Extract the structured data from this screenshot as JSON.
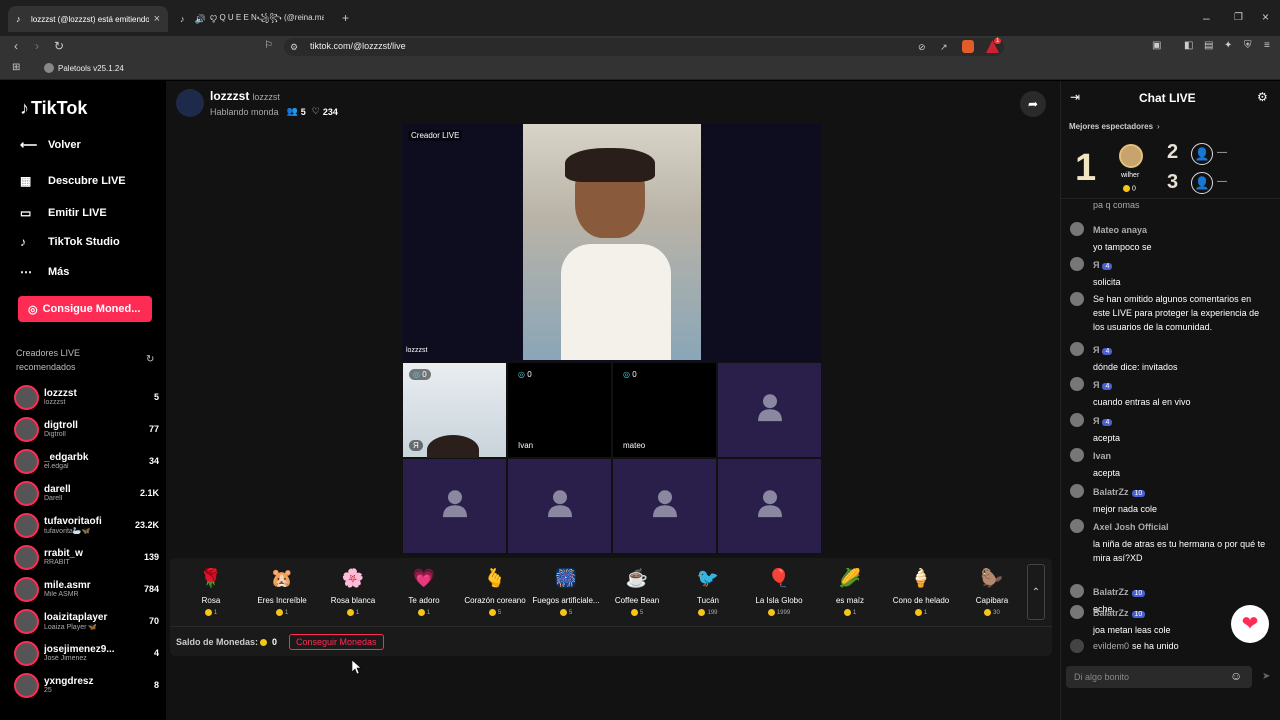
{
  "browser": {
    "tabs": [
      {
        "label": "lozzzst (@lozzzst) está emitiendo",
        "active": true
      },
      {
        "label": "ꨄ︎ Q U E E N꧁꧂ (@reina.may2",
        "active": false
      }
    ],
    "new_tab": "+",
    "url": "tiktok.com/@lozzzst/live",
    "bookmark": "Paletools v25.1.24",
    "ext_badge": "1"
  },
  "sidebar": {
    "logo": "TikTok",
    "nav": [
      {
        "label": "Volver",
        "icon": "back-icon"
      },
      {
        "label": "Descubre LIVE",
        "icon": "discover-icon"
      },
      {
        "label": "Emitir LIVE",
        "icon": "camera-icon"
      },
      {
        "label": "TikTok Studio",
        "icon": "studio-icon"
      },
      {
        "label": "Más",
        "icon": "more-icon"
      }
    ],
    "coin_button": "Consigue Moned...",
    "recommended_title": "Creadores LIVE recomendados",
    "creators": [
      {
        "name": "lozzzst",
        "sub": "lozzzst",
        "count": "5"
      },
      {
        "name": "digtroll",
        "sub": "Digtroll",
        "count": "77"
      },
      {
        "name": "_edgarbk",
        "sub": "el.edgal",
        "count": "34"
      },
      {
        "name": "darell",
        "sub": "Darell",
        "count": "2.1K"
      },
      {
        "name": "tufavoritaofi",
        "sub": "tufavorita🦢🦋",
        "count": "23.2K"
      },
      {
        "name": "rrabit_w",
        "sub": "RRABIT",
        "count": "139"
      },
      {
        "name": "mile.asmr",
        "sub": "Mile ASMR",
        "count": "784"
      },
      {
        "name": "loaizitaplayer",
        "sub": "Loaiza Player 🦋",
        "count": "70"
      },
      {
        "name": "josejimenez9...",
        "sub": "José Jimenez",
        "count": "4"
      },
      {
        "name": "yxngdresz",
        "sub": "25",
        "count": "8"
      }
    ]
  },
  "stream": {
    "host_name": "lozzzst",
    "host_handle": "lozzzst",
    "subtitle": "Hablando monda",
    "viewers": "5",
    "likes": "234",
    "creator_label": "Creador LIVE",
    "host_tag": "lozzzst",
    "guests": [
      {
        "badge": "0",
        "name": "Я"
      },
      {
        "badge": "0",
        "name": "Ivan"
      },
      {
        "badge": "0",
        "name": "mateo"
      }
    ]
  },
  "gifts": [
    {
      "name": "Rosa",
      "price": "1",
      "icon": "🌹"
    },
    {
      "name": "Eres Increíble",
      "price": "1",
      "icon": "🐹"
    },
    {
      "name": "Rosa blanca",
      "price": "1",
      "icon": "🌸"
    },
    {
      "name": "Te adoro",
      "price": "1",
      "icon": "💗"
    },
    {
      "name": "Corazón coreano",
      "price": "5",
      "icon": "🫰"
    },
    {
      "name": "Fuegos artificiale...",
      "price": "5",
      "icon": "🎆"
    },
    {
      "name": "Coffee Bean",
      "price": "5",
      "icon": "☕"
    },
    {
      "name": "Tucán",
      "price": "199",
      "icon": "🐦"
    },
    {
      "name": "La Isla Globo",
      "price": "1999",
      "icon": "🎈"
    },
    {
      "name": "es maíz",
      "price": "1",
      "icon": "🌽"
    },
    {
      "name": "Cono de helado",
      "price": "1",
      "icon": "🍦"
    },
    {
      "name": "Capibara",
      "price": "30",
      "icon": "🦫"
    }
  ],
  "balance": {
    "label": "Saldo de Monedas:",
    "value": "0",
    "get_coins": "Conseguir Monedas"
  },
  "chat": {
    "title": "Chat LIVE",
    "top_viewers_label": "Mejores espectadores",
    "rank1": "1",
    "rank1_name": "wilher",
    "rank1_coins": "0",
    "rank2": "2",
    "rank3": "3",
    "empty": "—",
    "partial_line": "pa q comas",
    "messages": [
      {
        "user": "Mateo anaya",
        "level": "",
        "text": "yo tampoco se"
      },
      {
        "user": "Я",
        "level": "4",
        "text": "solicita"
      },
      {
        "user": "",
        "level": "",
        "text": "Se han omitido algunos comentarios en este LIVE para proteger la experiencia de los usuarios de la comunidad."
      },
      {
        "user": "Я",
        "level": "4",
        "text": "dónde dice: invitados"
      },
      {
        "user": "Я",
        "level": "4",
        "text": "cuando entras al en vivo"
      },
      {
        "user": "Я",
        "level": "4",
        "text": "acepta"
      },
      {
        "user": "Ivan",
        "level": "",
        "text": "acepta"
      },
      {
        "user": "BalatrZz",
        "level": "10",
        "text": "mejor nada cole"
      },
      {
        "user": "Axel Josh Official",
        "level": "",
        "text": "la niña de atras es tu hermana o por qué te mira así?XD"
      },
      {
        "user": "BalatrZz",
        "level": "10",
        "text": "eche"
      },
      {
        "user": "BalatrZz",
        "level": "10",
        "text": "joa metan leas cole"
      }
    ],
    "joined_user": "evildem0",
    "joined_text": "se ha unido",
    "input_placeholder": "Di algo bonito"
  },
  "colors": {
    "accent": "#fe2c55",
    "coin": "#f5c518",
    "cell": "#2a1f4a"
  }
}
